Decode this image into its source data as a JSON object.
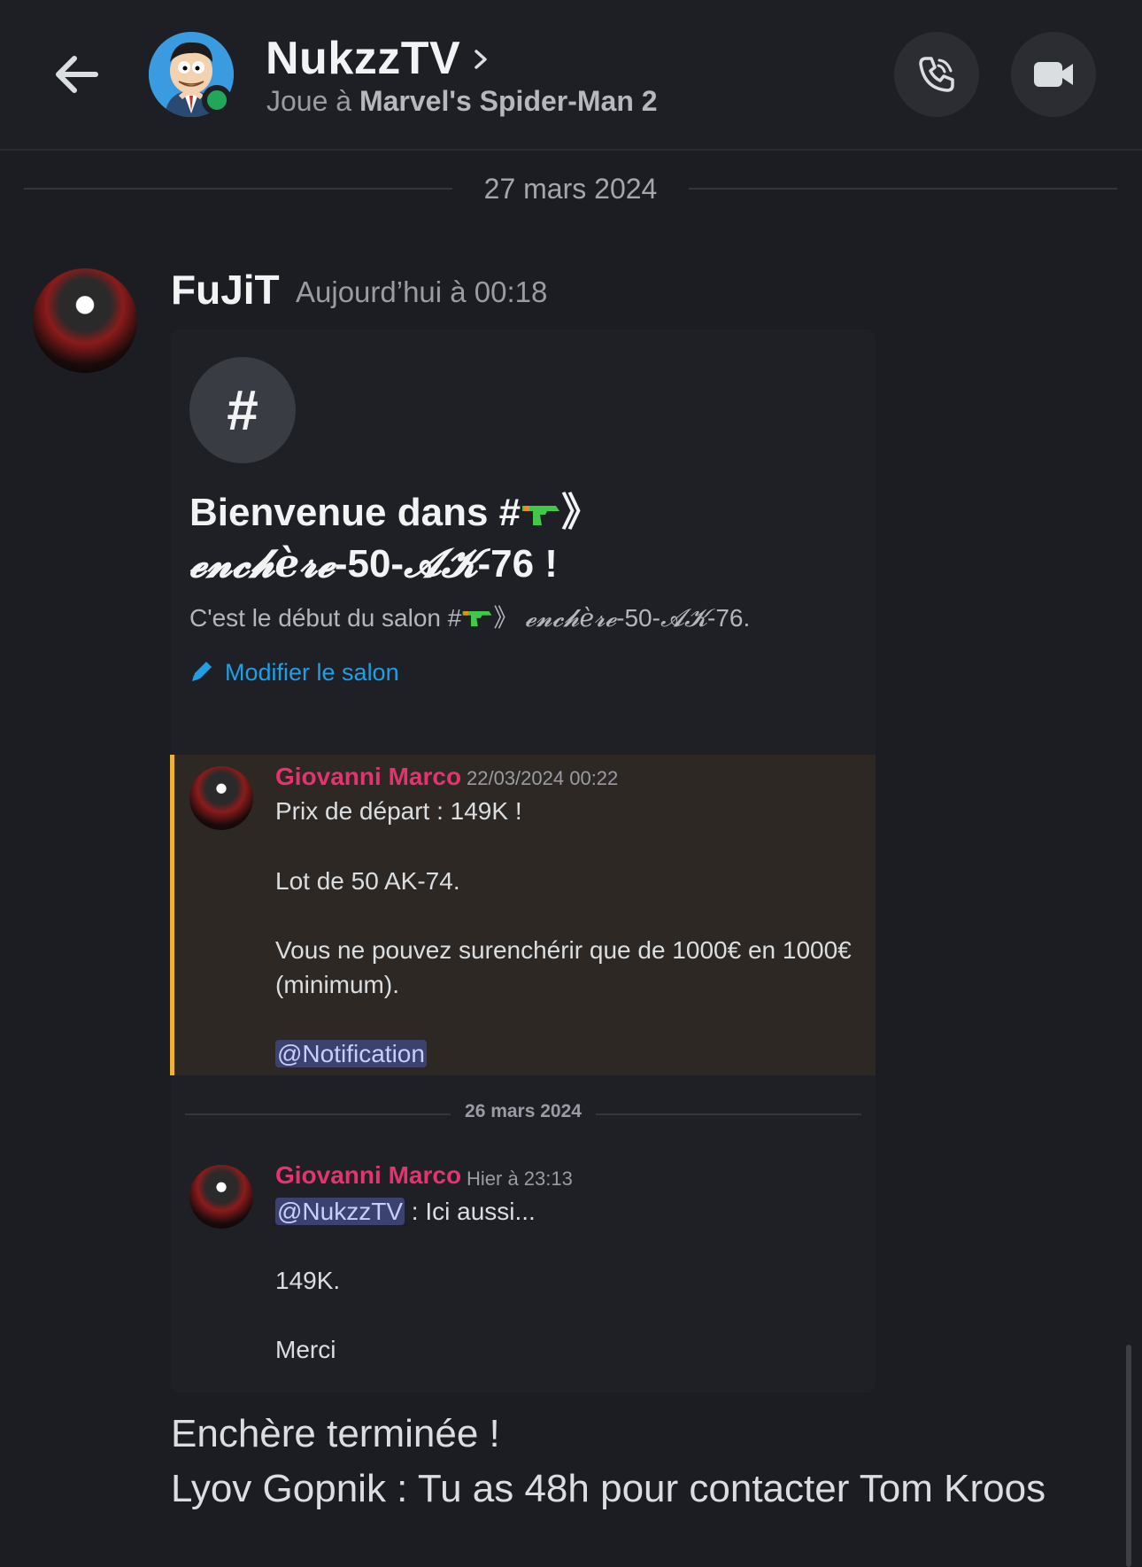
{
  "header": {
    "name": "NukzzTV",
    "activity_prefix": "Joue à",
    "activity_game": "Marvel's Spider-Man 2"
  },
  "date_divider_main": "27 mars 2024",
  "message": {
    "author": "FuJiT",
    "timestamp": "Aujourd’hui à 00:18"
  },
  "embed": {
    "hash_symbol": "#",
    "welcome_prefix": "Bienvenue dans #",
    "welcome_channel_arrows": "》",
    "welcome_channel_fancy": "𝓮𝓷𝓬𝓱è𝓻𝓮",
    "welcome_channel_mid": "-50-",
    "welcome_channel_fancy2": "𝓐𝓚",
    "welcome_channel_tail": "-76 !",
    "start_prefix": "C'est le début du salon #",
    "start_arrows": "》",
    "start_fancy": "𝓮𝓷𝓬𝓱è𝓻𝓮",
    "start_mid": "-50-",
    "start_fancy2": "𝓐𝓚",
    "start_tail": "-76.",
    "edit_label": "Modifier le salon"
  },
  "quoted_message": {
    "author": "Giovanni Marco",
    "timestamp": "22/03/2024 00:22",
    "lines": [
      "Prix de départ : 149K !",
      "Lot de 50 AK-74.",
      "Vous ne pouvez surenchérir que de 1000€ en 1000€",
      "(minimum).",
      "@Notification"
    ],
    "accent_color": "#f0b232"
  },
  "date_divider_sub": "26 mars 2024",
  "reply_message": {
    "author": "Giovanni Marco",
    "timestamp": "Hier à 23:13",
    "mention": "@NukzzTV",
    "mention_suffix": " : Ici aussi...",
    "line2": "149K.",
    "line3": "Merci"
  },
  "final": {
    "line1": "Enchère terminée !",
    "line2": "Lyov Gopnik : Tu as 48h pour contacter Tom Kroos"
  },
  "colors": {
    "background": "#1c1d22",
    "author_pink": "#e2346e",
    "link_blue": "#1e9fe6",
    "online_green": "#23a55a"
  }
}
